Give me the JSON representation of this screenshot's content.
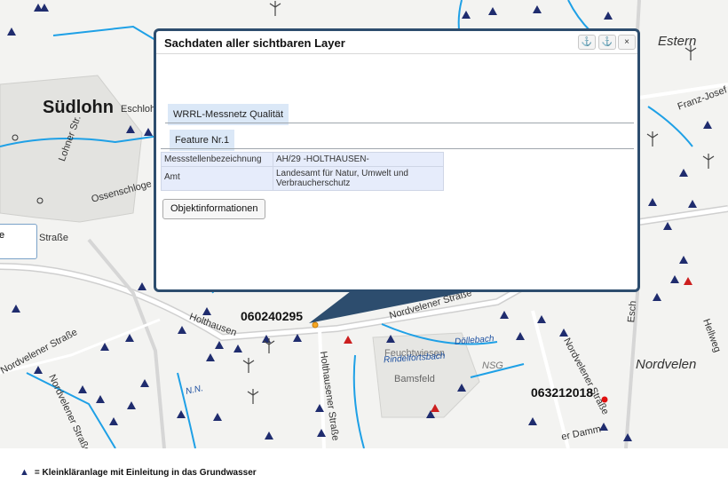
{
  "map": {
    "places": {
      "suedlohn": "Südlohn",
      "estern": "Estern",
      "nordvelen": "Nordvelen"
    },
    "streets": {
      "eschlohn": "Eschloh",
      "loehner": "Lohner Str.",
      "ossenschlo": "Ossenschloge",
      "strasse_left": "Straße",
      "holthausen": "Holthausen",
      "nordvelener_left": "Nordvelener Straße",
      "nordvelener_left2": "Nordvelener Straße",
      "holthausener": "Holthausener Straße",
      "nordvelener_mid": "Nordvelener Straße",
      "nordvelener_right": "Nordvelener Straße",
      "franz_josef": "Franz-Josef",
      "hellweg": "Hellweg",
      "eschstr": "Esch",
      "damm": "er Damm",
      "bamsfeld": "Bamsfeld",
      "fauchwiesen": "Feuchtwiesen",
      "nsg": "NSG"
    },
    "waters": {
      "rindelfortsbach": "Rindelfortsbach",
      "doellebach": "Döllebach",
      "nn": "N.N."
    },
    "codes": {
      "left": "060240295",
      "right": "063212018"
    },
    "side_stub_text": "e"
  },
  "popup": {
    "title": "Sachdaten aller sichtbaren Layer",
    "buttons": {
      "dock": "⚓",
      "undock": "⚓",
      "close": "×"
    },
    "layer_tab": "WRRL-Messnetz Qualität",
    "feature_tab": "Feature Nr.1",
    "attributes": [
      {
        "key": "Messstellenbezeichnung",
        "value": "AH/29 -HOLTHAUSEN-"
      },
      {
        "key": "Amt",
        "value": "Landesamt für Natur, Umwelt und Verbraucherschutz"
      }
    ],
    "object_button": "Objektinformationen"
  },
  "legend": {
    "symbol": "▲",
    "text": "= Kleinkläranlage mit Einleitung in das Grundwasser"
  },
  "colors": {
    "popup_border": "#2d4d6e",
    "tab_bg": "#dbe8f7",
    "table_bg": "#e6ecfb",
    "water": "#1ea0e6",
    "triangle_navy": "#1f2c6e",
    "triangle_red": "#cc1f1f"
  }
}
